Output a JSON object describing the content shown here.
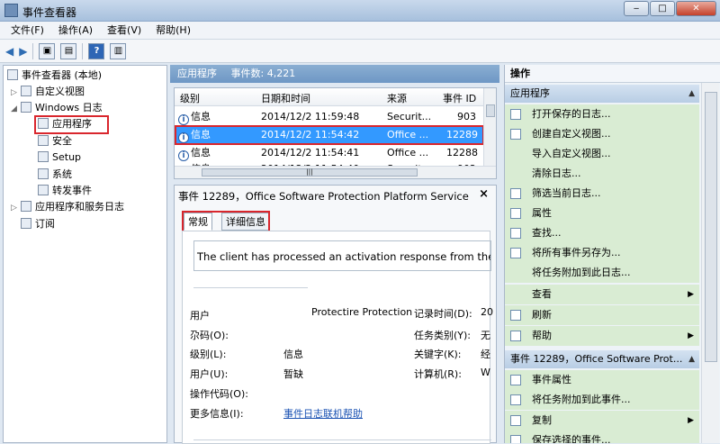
{
  "window": {
    "title": "事件查看器"
  },
  "menu": [
    "文件(F)",
    "操作(A)",
    "查看(V)",
    "帮助(H)"
  ],
  "tree": {
    "root": "事件查看器 (本地)",
    "custom_views": "自定义视图",
    "windows_logs": "Windows 日志",
    "application": "应用程序",
    "security": "安全",
    "setup": "Setup",
    "system": "系统",
    "forwarded": "转发事件",
    "apps_services": "应用程序和服务日志",
    "subscriptions": "订阅"
  },
  "log_header": {
    "name": "应用程序",
    "count_label": "事件数: 4,221"
  },
  "list": {
    "columns": [
      "级别",
      "日期和时间",
      "来源",
      "事件 ID"
    ],
    "rows": [
      {
        "level": "信息",
        "datetime": "2014/12/2 11:59:48",
        "source": "Securit...",
        "id": "903"
      },
      {
        "level": "信息",
        "datetime": "2014/12/2 11:54:42",
        "source": "Office ...",
        "id": "12289"
      },
      {
        "level": "信息",
        "datetime": "2014/12/2 11:54:41",
        "source": "Office ...",
        "id": "12288"
      },
      {
        "level": "信息",
        "datetime": "2014/12/2 11:54:40",
        "source": "Securit...",
        "id": "902"
      }
    ],
    "hscroll_glyph": "|||"
  },
  "detail": {
    "title": "事件 12289，Office Software Protection Platform Service",
    "close": "×",
    "tabs": [
      "常规",
      "详细信息"
    ],
    "description": "The client has processed an activation response from the key",
    "fields": {
      "user_top_label": "用户",
      "user_top_value": "Protectire Protection",
      "opcode_label": "尕码(O):",
      "level_label": "级别(L):",
      "level_value": "信息",
      "user_label": "用户(U):",
      "user_value": "暂缺",
      "opcode2_label": "操作代码(O):",
      "more_info_label": "更多信息(I):",
      "more_info_link": "事件日志联机帮助",
      "logged_label": "记录时间(D):",
      "logged_value": "20",
      "category_label": "任务类别(Y):",
      "category_value": "无",
      "keywords_label": "关键字(K):",
      "keywords_value": "经",
      "computer_label": "计算机(R):",
      "computer_value": "W"
    }
  },
  "actions": {
    "header": "操作",
    "group1": "应用程序",
    "group1_items": [
      "打开保存的日志...",
      "创建自定义视图...",
      "导入自定义视图...",
      "清除日志...",
      "筛选当前日志...",
      "属性",
      "查找...",
      "将所有事件另存为...",
      "将任务附加到此日志...",
      "查看",
      "刷新",
      "帮助"
    ],
    "group2": "事件 12289，Office Software Prot...",
    "group2_items": [
      "事件属性",
      "将任务附加到此事件...",
      "复制",
      "保存选择的事件..."
    ]
  }
}
